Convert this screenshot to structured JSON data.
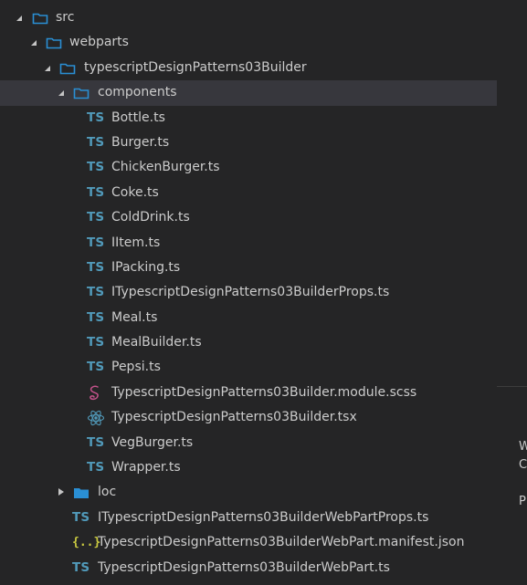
{
  "colors": {
    "background": "#252526",
    "selected_row": "#37373d",
    "text": "#cccccc",
    "folder_icon": "#2a8fd4",
    "ts_icon": "#519aba",
    "json_icon": "#cbcb41",
    "scss_icon": "#c6538c",
    "react_icon": "#519aba"
  },
  "tree": [
    {
      "label": "src",
      "type": "folder",
      "level": 0,
      "expanded": true
    },
    {
      "label": "webparts",
      "type": "folder",
      "level": 1,
      "expanded": true
    },
    {
      "label": "typescriptDesignPatterns03Builder",
      "type": "folder",
      "level": 2,
      "expanded": true
    },
    {
      "label": "components",
      "type": "folder",
      "level": 3,
      "expanded": true,
      "selected": true
    },
    {
      "label": "Bottle.ts",
      "type": "ts",
      "level": 4
    },
    {
      "label": "Burger.ts",
      "type": "ts",
      "level": 4
    },
    {
      "label": "ChickenBurger.ts",
      "type": "ts",
      "level": 4
    },
    {
      "label": "Coke.ts",
      "type": "ts",
      "level": 4
    },
    {
      "label": "ColdDrink.ts",
      "type": "ts",
      "level": 4
    },
    {
      "label": "IItem.ts",
      "type": "ts",
      "level": 4
    },
    {
      "label": "IPacking.ts",
      "type": "ts",
      "level": 4
    },
    {
      "label": "ITypescriptDesignPatterns03BuilderProps.ts",
      "type": "ts",
      "level": 4
    },
    {
      "label": "Meal.ts",
      "type": "ts",
      "level": 4
    },
    {
      "label": "MealBuilder.ts",
      "type": "ts",
      "level": 4
    },
    {
      "label": "Pepsi.ts",
      "type": "ts",
      "level": 4
    },
    {
      "label": "TypescriptDesignPatterns03Builder.module.scss",
      "type": "scss",
      "level": 4
    },
    {
      "label": "TypescriptDesignPatterns03Builder.tsx",
      "type": "tsx",
      "level": 4
    },
    {
      "label": "VegBurger.ts",
      "type": "ts",
      "level": 4
    },
    {
      "label": "Wrapper.ts",
      "type": "ts",
      "level": 4
    },
    {
      "label": "loc",
      "type": "folder",
      "level": 3,
      "expanded": false,
      "filled": true
    },
    {
      "label": "ITypescriptDesignPatterns03BuilderWebPartProps.ts",
      "type": "ts",
      "level": 3
    },
    {
      "label": "TypescriptDesignPatterns03BuilderWebPart.manifest.json",
      "type": "json",
      "level": 3
    },
    {
      "label": "TypescriptDesignPatterns03BuilderWebPart.ts",
      "type": "ts",
      "level": 3
    }
  ],
  "icons": {
    "ts_text": "TS",
    "json_text": "{..}"
  },
  "right_fragments": [
    "W",
    "C",
    "P"
  ]
}
